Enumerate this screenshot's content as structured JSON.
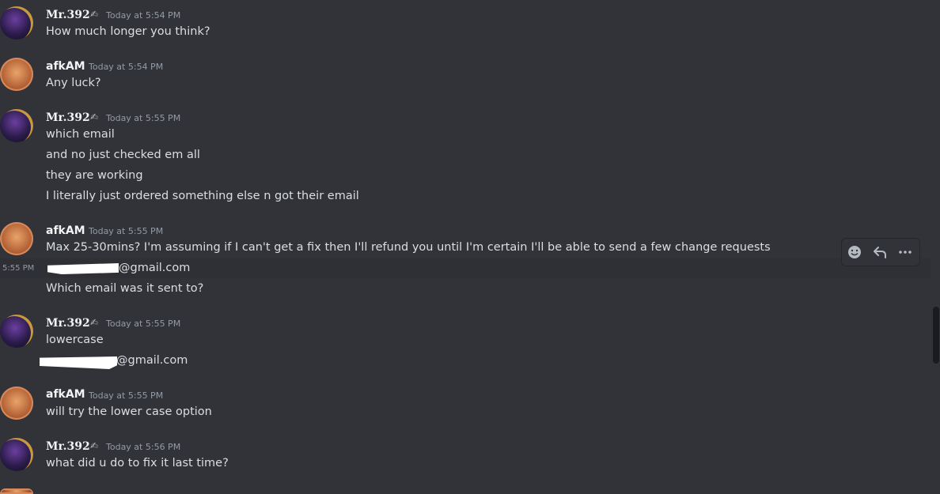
{
  "users": {
    "mr": {
      "name": "Mr.392"
    },
    "afk": {
      "name": "afkAM"
    }
  },
  "groups": [
    {
      "user": "Mr.392",
      "time": "Today at 5:54 PM",
      "lines": [
        "How much longer you think?"
      ]
    },
    {
      "user": "afkAM",
      "time": "Today at 5:54 PM",
      "lines": [
        "Any luck?"
      ]
    },
    {
      "user": "Mr.392",
      "time": "Today at 5:55 PM",
      "lines": [
        "which email",
        "and no just checked em all",
        "they are working",
        "I literally just ordered something else n got their email"
      ]
    },
    {
      "user": "afkAM",
      "time": "Today at 5:55 PM",
      "lines": [
        "Max 25-30mins? I'm assuming if I can't get a fix then I'll refund you until I'm certain I'll be able to send a few change requests",
        "@gmail.com",
        "Which email was it sent to?"
      ],
      "hover_time": "5:55 PM"
    },
    {
      "user": "Mr.392",
      "time": "Today at 5:55 PM",
      "lines": [
        "lowercase",
        "@gmail.com"
      ]
    },
    {
      "user": "afkAM",
      "time": "Today at 5:55 PM",
      "lines": [
        "will try the lower case option"
      ]
    },
    {
      "user": "Mr.392",
      "time": "Today at 5:56 PM",
      "lines": [
        "what did u do to fix it last time?"
      ]
    }
  ],
  "toolbar": {
    "icons": [
      "add-reaction-icon",
      "reply-icon",
      "more-options-icon"
    ]
  },
  "colors": {
    "background": "#313338",
    "username": "#f2f3f5",
    "timestamp": "#949ba4",
    "message": "#dbdee1"
  }
}
